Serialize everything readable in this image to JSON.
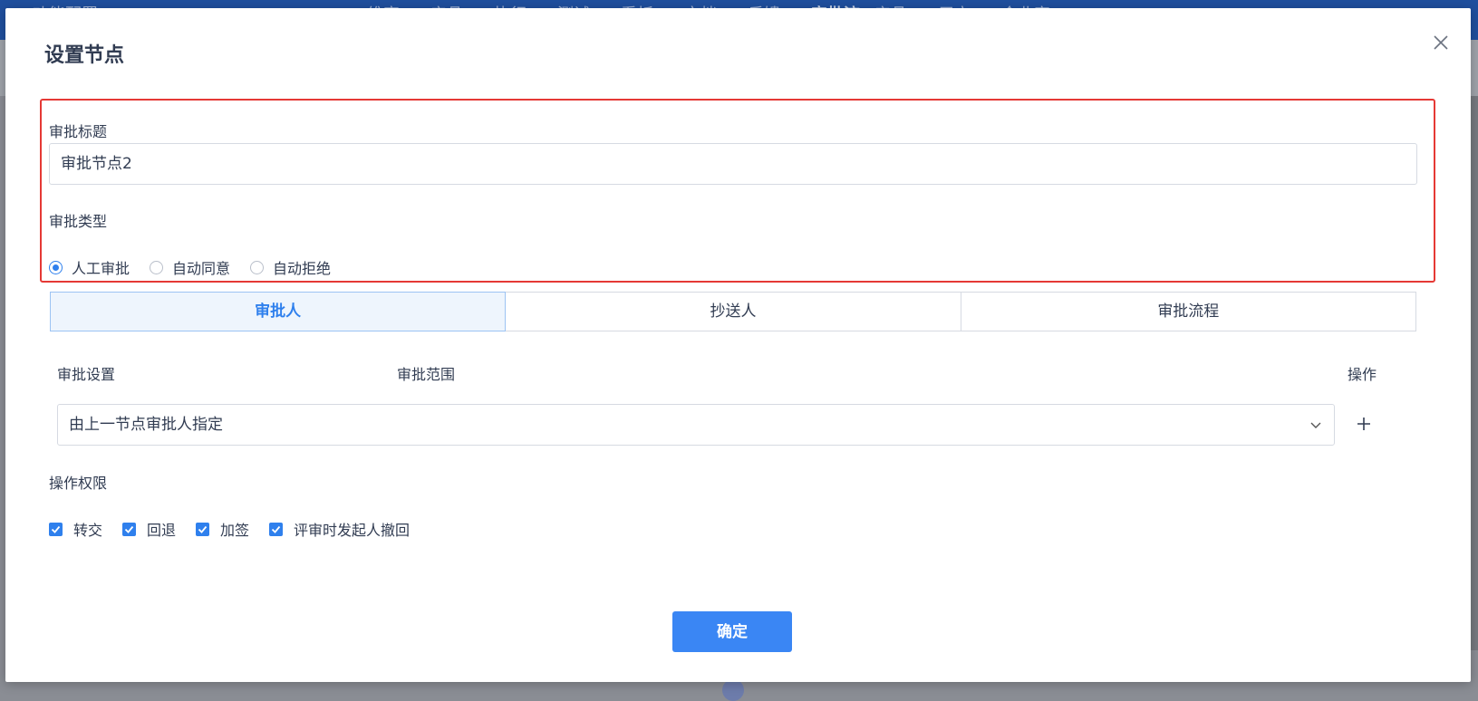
{
  "background": {
    "app_title": "功能配置",
    "nav": [
      "维客",
      "产品",
      "执行",
      "测试",
      "看板",
      "文档",
      "反馈",
      "审批流",
      "产品",
      "用户",
      "企业家"
    ]
  },
  "dialog": {
    "title": "设置节点",
    "close_icon": "close-icon"
  },
  "form": {
    "title_label": "审批标题",
    "title_value": "审批节点2",
    "type_label": "审批类型",
    "type_options": [
      {
        "label": "人工审批",
        "checked": true
      },
      {
        "label": "自动同意",
        "checked": false
      },
      {
        "label": "自动拒绝",
        "checked": false
      }
    ]
  },
  "tabs": [
    {
      "label": "审批人",
      "active": true
    },
    {
      "label": "抄送人",
      "active": false
    },
    {
      "label": "审批流程",
      "active": false
    }
  ],
  "approvers": {
    "col_setting": "审批设置",
    "col_scope": "审批范围",
    "col_action": "操作",
    "setting_value": "由上一节点审批人指定"
  },
  "permissions": {
    "label": "操作权限",
    "items": [
      {
        "label": "转交",
        "checked": true
      },
      {
        "label": "回退",
        "checked": true
      },
      {
        "label": "加签",
        "checked": true
      },
      {
        "label": "评审时发起人撤回",
        "checked": true
      }
    ]
  },
  "footer": {
    "confirm_label": "确定"
  },
  "colors": {
    "accent": "#3a86f4",
    "highlight_border": "#e53935"
  }
}
